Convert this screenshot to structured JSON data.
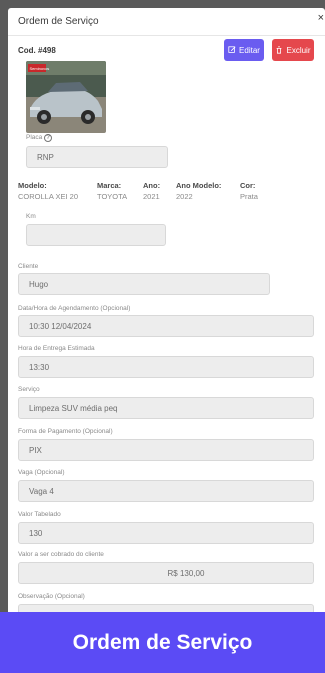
{
  "modal": {
    "title": "Ordem de Serviço",
    "close": "×"
  },
  "order": {
    "code": "Cod. #498"
  },
  "actions": {
    "edit": "Editar",
    "delete": "Excluir"
  },
  "vehicle": {
    "photo_tag": "Seminovos",
    "plate_label": "Placa",
    "plate": "RNP",
    "model_label": "Modelo:",
    "model": "COROLLA XEI 20",
    "brand_label": "Marca:",
    "brand": "TOYOTA",
    "year_label": "Ano:",
    "year": "2021",
    "model_year_label": "Ano Modelo:",
    "model_year": "2022",
    "color_label": "Cor:",
    "color": "Prata",
    "km_label": "Km",
    "km": ""
  },
  "form": {
    "client_label": "Cliente",
    "client": "Hugo",
    "schedule_label": "Data/Hora de Agendamento (Opcional)",
    "schedule": "10:30 12/04/2024",
    "delivery_label": "Hora de Entrega Estimada",
    "delivery": "13:30",
    "service_label": "Serviço",
    "service": "Limpeza SUV média peq",
    "payment_label": "Forma de Pagamento (Opcional)",
    "payment": "PIX",
    "slot_label": "Vaga (Opcional)",
    "slot": "Vaga 4",
    "table_value_label": "Valor Tabelado",
    "table_value": "130",
    "charged_label": "Valor a ser cobrado do cliente",
    "charged": "R$ 130,00",
    "notes_label": "Observação (Opcional)",
    "notes": ""
  },
  "banner": {
    "text": "Ordem de Serviço"
  },
  "colors": {
    "accent": "#5b4bf5",
    "edit": "#6a5cf0",
    "delete": "#e5484d"
  }
}
